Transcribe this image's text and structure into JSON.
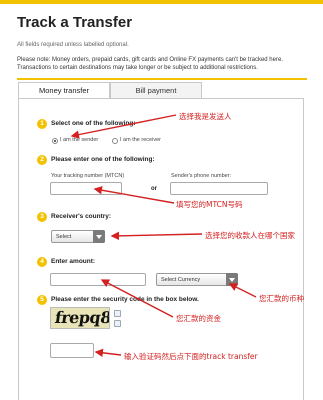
{
  "page": {
    "title": "Track a Transfer",
    "required_note": "All fields required unless labelled optional.",
    "note": "Please note: Money orders, prepaid cards, gift cards and Online FX payments can't be tracked here. Transactions to certain destinations may take longer or be subject to additional restrictions."
  },
  "tabs": [
    {
      "label": "Money transfer",
      "active": true
    },
    {
      "label": "Bill payment",
      "active": false
    }
  ],
  "steps": {
    "s1": {
      "num": "1",
      "label": "Select one of the following:",
      "options": [
        "I am the sender",
        "I am the receiver"
      ],
      "selected": 0
    },
    "s2": {
      "num": "2",
      "label": "Please enter one of the following:",
      "mtcn_label": "Your tracking number (MTCN)",
      "or": "or",
      "phone_label": "Sender's phone number:"
    },
    "s3": {
      "num": "3",
      "label": "Receiver's country:",
      "select_value": "Select"
    },
    "s4": {
      "num": "4",
      "label": "Enter amount:",
      "currency_value": "Select Currency"
    },
    "s5": {
      "num": "5",
      "label": "Please enter the security code in the box below.",
      "captcha_text": "frepq8"
    }
  },
  "annotations": {
    "a1": "选择我是发送人",
    "a2": "填写您的MTCN号码",
    "a3": "选择您的收款人在哪个国家",
    "a4": "您汇款的币种",
    "a5": "您汇款的资金",
    "a6": "输入验证码然后点下面的track transfer"
  },
  "colors": {
    "accent": "#f2c200",
    "annotation": "#d42020"
  }
}
